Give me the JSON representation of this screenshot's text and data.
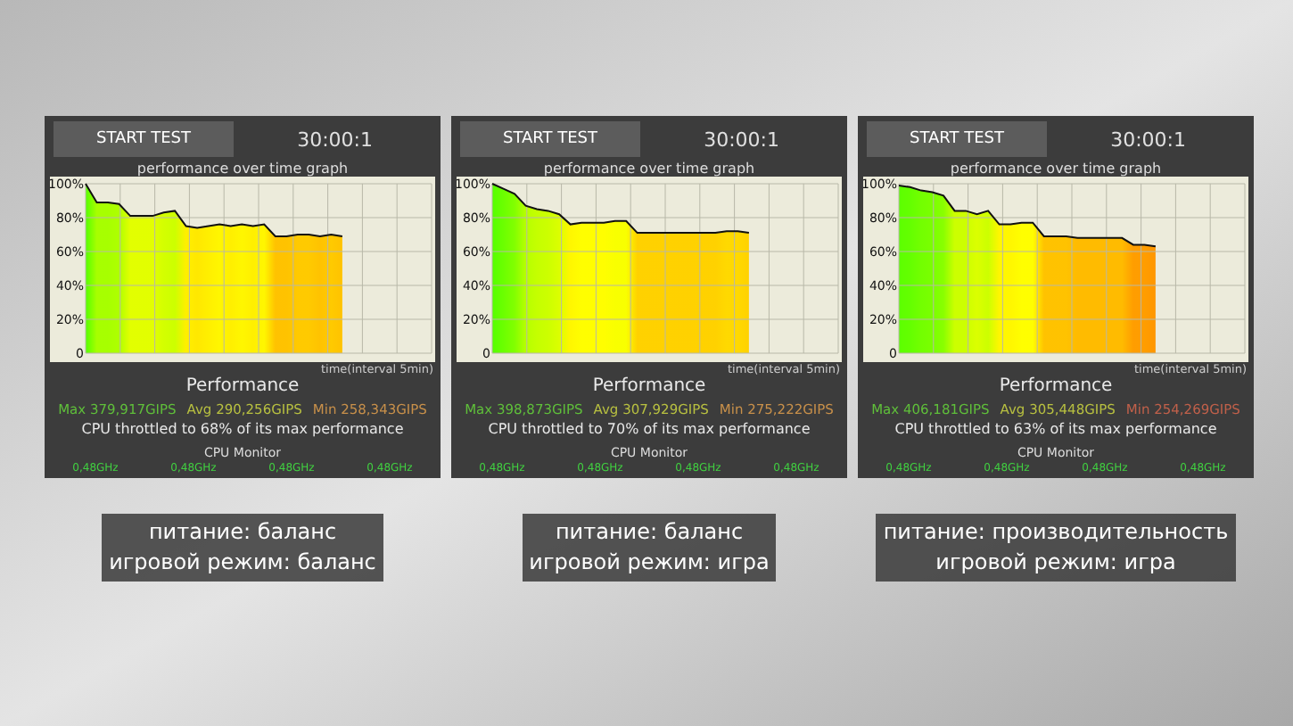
{
  "panels": [
    {
      "button": "START TEST",
      "timer": "30:00:1",
      "chart_data": {
        "type": "area",
        "title": "performance over time graph",
        "xlabel": "time(interval 5min)",
        "ylim": [
          0,
          100
        ],
        "grid": true,
        "yticks": [
          {
            "value": 0,
            "label": "0"
          },
          {
            "value": 20,
            "label": "20%"
          },
          {
            "value": 40,
            "label": "40%"
          },
          {
            "value": 60,
            "label": "60%"
          },
          {
            "value": 80,
            "label": "80%"
          },
          {
            "value": 100,
            "label": "100%"
          }
        ],
        "series": [
          {
            "color": "#111111",
            "values": [
              100,
              89,
              89,
              88,
              81,
              81,
              81,
              83,
              84,
              75,
              74,
              75,
              76,
              75,
              76,
              75,
              76,
              69,
              69,
              70,
              70,
              69,
              70,
              69,
              null,
              null,
              null,
              null,
              null,
              null,
              null,
              null
            ]
          }
        ]
      },
      "heading": "Performance",
      "stats": [
        {
          "text": "Max 379,917GIPS",
          "color": "#5fbf3a"
        },
        {
          "text": "Avg 290,256GIPS",
          "color": "#b8c040"
        },
        {
          "text": "Min 258,343GIPS",
          "color": "#c8904a"
        }
      ],
      "summary": "CPU throttled to 68% of its max performance",
      "monitor": "CPU Monitor",
      "clocks": [
        "0,48GHz",
        "0,48GHz",
        "0,48GHz",
        "0,48GHz"
      ],
      "caption": [
        "питание: баланс",
        "игровой режим: баланс"
      ]
    },
    {
      "button": "START TEST",
      "timer": "30:00:1",
      "chart_data": {
        "type": "area",
        "title": "performance over time graph",
        "xlabel": "time(interval 5min)",
        "ylim": [
          0,
          100
        ],
        "grid": true,
        "yticks": [
          {
            "value": 0,
            "label": "0"
          },
          {
            "value": 20,
            "label": "20%"
          },
          {
            "value": 40,
            "label": "40%"
          },
          {
            "value": 60,
            "label": "60%"
          },
          {
            "value": 80,
            "label": "80%"
          },
          {
            "value": 100,
            "label": "100%"
          }
        ],
        "series": [
          {
            "color": "#111111",
            "values": [
              100,
              97,
              94,
              87,
              85,
              84,
              82,
              76,
              77,
              77,
              77,
              78,
              78,
              71,
              71,
              71,
              71,
              71,
              71,
              71,
              71,
              72,
              72,
              71,
              null,
              null,
              null,
              null,
              null,
              null,
              null,
              null
            ]
          }
        ]
      },
      "heading": "Performance",
      "stats": [
        {
          "text": "Max 398,873GIPS",
          "color": "#5fbf3a"
        },
        {
          "text": "Avg 307,929GIPS",
          "color": "#b8c040"
        },
        {
          "text": "Min 275,222GIPS",
          "color": "#c8904a"
        }
      ],
      "summary": "CPU throttled to 70% of its max performance",
      "monitor": "CPU Monitor",
      "clocks": [
        "0,48GHz",
        "0,48GHz",
        "0,48GHz",
        "0,48GHz"
      ],
      "caption": [
        "питание: баланс",
        "игровой режим: игра"
      ]
    },
    {
      "button": "START TEST",
      "timer": "30:00:1",
      "chart_data": {
        "type": "area",
        "title": "performance over time graph",
        "xlabel": "time(interval 5min)",
        "ylim": [
          0,
          100
        ],
        "grid": true,
        "yticks": [
          {
            "value": 0,
            "label": "0"
          },
          {
            "value": 20,
            "label": "20%"
          },
          {
            "value": 40,
            "label": "40%"
          },
          {
            "value": 60,
            "label": "60%"
          },
          {
            "value": 80,
            "label": "80%"
          },
          {
            "value": 100,
            "label": "100%"
          }
        ],
        "series": [
          {
            "color": "#111111",
            "values": [
              99,
              98,
              96,
              95,
              93,
              84,
              84,
              82,
              84,
              76,
              76,
              77,
              77,
              69,
              69,
              69,
              68,
              68,
              68,
              68,
              68,
              64,
              64,
              63,
              null,
              null,
              null,
              null,
              null,
              null,
              null,
              null
            ]
          }
        ]
      },
      "heading": "Performance",
      "stats": [
        {
          "text": "Max 406,181GIPS",
          "color": "#5fbf3a"
        },
        {
          "text": "Avg 305,448GIPS",
          "color": "#b8c040"
        },
        {
          "text": "Min 254,269GIPS",
          "color": "#c0604a"
        }
      ],
      "summary": "CPU throttled to 63% of its max performance",
      "monitor": "CPU Monitor",
      "clocks": [
        "0,48GHz",
        "0,48GHz",
        "0,48GHz",
        "0,48GHz"
      ],
      "caption": [
        "питание: производительность",
        "игровой режим: игра"
      ]
    }
  ]
}
